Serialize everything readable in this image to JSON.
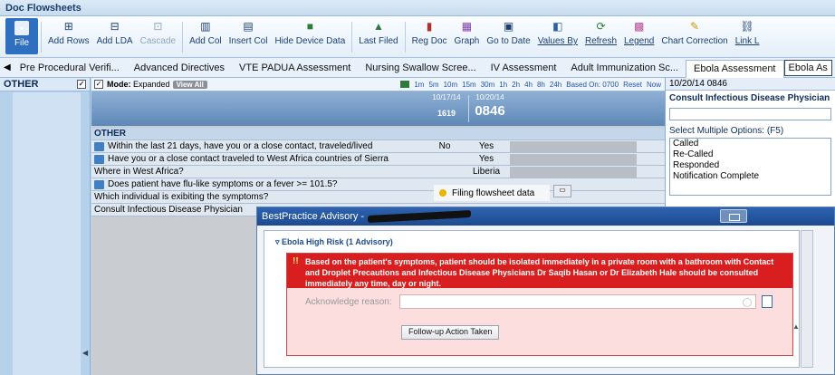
{
  "window": {
    "title": "Doc Flowsheets"
  },
  "toolbar": {
    "buttons": [
      {
        "label": "File",
        "icon": "file-icon"
      },
      {
        "label": "Add Rows",
        "icon": "add-rows-icon"
      },
      {
        "label": "Add LDA",
        "icon": "add-lda-icon"
      },
      {
        "label": "Cascade",
        "icon": "cascade-icon"
      },
      {
        "label": "Add Col",
        "icon": "add-col-icon"
      },
      {
        "label": "Insert Col",
        "icon": "insert-col-icon"
      },
      {
        "label": "Hide Device Data",
        "icon": "hide-device-icon"
      },
      {
        "label": "Last Filed",
        "icon": "last-filed-icon"
      },
      {
        "label": "Reg Doc",
        "icon": "reg-doc-icon"
      },
      {
        "label": "Graph",
        "icon": "graph-icon"
      },
      {
        "label": "Go to Date",
        "icon": "go-to-date-icon"
      },
      {
        "label": "Values By",
        "icon": "values-by-icon"
      },
      {
        "label": "Refresh",
        "icon": "refresh-icon"
      },
      {
        "label": "Legend",
        "icon": "legend-icon"
      },
      {
        "label": "Chart Correction",
        "icon": "chart-correction-icon"
      },
      {
        "label": "Link L",
        "icon": "link-icon"
      }
    ]
  },
  "tabs": [
    {
      "label": "Pre Procedural Verifi..."
    },
    {
      "label": "Advanced Directives"
    },
    {
      "label": "VTE PADUA Assessment"
    },
    {
      "label": "Nursing Swallow Scree..."
    },
    {
      "label": "IV Assessment"
    },
    {
      "label": "Adult Immunization Sc..."
    },
    {
      "label": "Ebola Assessment"
    },
    {
      "label": "Ebola As"
    }
  ],
  "leftpanel": {
    "header": "OTHER",
    "checked_mark": "✓"
  },
  "modebar": {
    "mode_label": "Mode:",
    "mode_value": "Expanded",
    "view_all": "View All",
    "intervals": [
      "1m",
      "5m",
      "10m",
      "15m",
      "30m",
      "1h",
      "2h",
      "4h",
      "8h",
      "24h"
    ],
    "based_on": "Based On: 0700",
    "reset": "Reset",
    "now": "Now"
  },
  "columns": [
    {
      "date": "10/17/14",
      "time": "1619"
    },
    {
      "date": "10/20/14",
      "time": "0846"
    }
  ],
  "rows": {
    "section": "OTHER",
    "r1": {
      "label": "Within the last 21 days, have you or a close contact, traveled/lived",
      "v1": "No",
      "v2": "Yes"
    },
    "r2": {
      "label": "Have you or a close contact traveled to West Africa countries of Sierra",
      "v1": "",
      "v2": "Yes"
    },
    "r3": {
      "label": "Where in West Africa?",
      "v1": "",
      "v2": "Liberia"
    },
    "r4": {
      "label": "Does patient have flu-like symptoms or a fever >= 101.5?",
      "v1": "",
      "v2": ""
    },
    "r5": {
      "label": "Which individual is exibiting the symptoms?",
      "v1": "",
      "v2": ""
    },
    "r6": {
      "label": "Consult Infectious Disease Physician",
      "v1": "",
      "v2": ""
    }
  },
  "filing": {
    "text": "Filing flowsheet data"
  },
  "rightpanel": {
    "header": "10/20/14 0846",
    "title": "Consult Infectious Disease Physician",
    "select_label": "Select Multiple Options: (F5)",
    "options": [
      "Called",
      "Re-Called",
      "Responded",
      "Notification Complete"
    ]
  },
  "dialog": {
    "title": "BestPractice Advisory -",
    "advisory_header": "Ebola High Risk (1 Advisory)",
    "advisory_bang": "!!",
    "advisory_text": "Based on the patient's symptoms, patient should be isolated immediately in a private room with a bathroom with Contact and Droplet Precautions and Infectious Disease Physicians Dr Saqib Hasan or Dr Elizabeth Hale should be consulted immediately any time, day or night.",
    "ack_label": "Acknowledge reason:",
    "followup_button": "Follow-up Action Taken"
  },
  "colors": {
    "advisory_red": "#d81e1e",
    "title_blue": "#1d4a90"
  }
}
